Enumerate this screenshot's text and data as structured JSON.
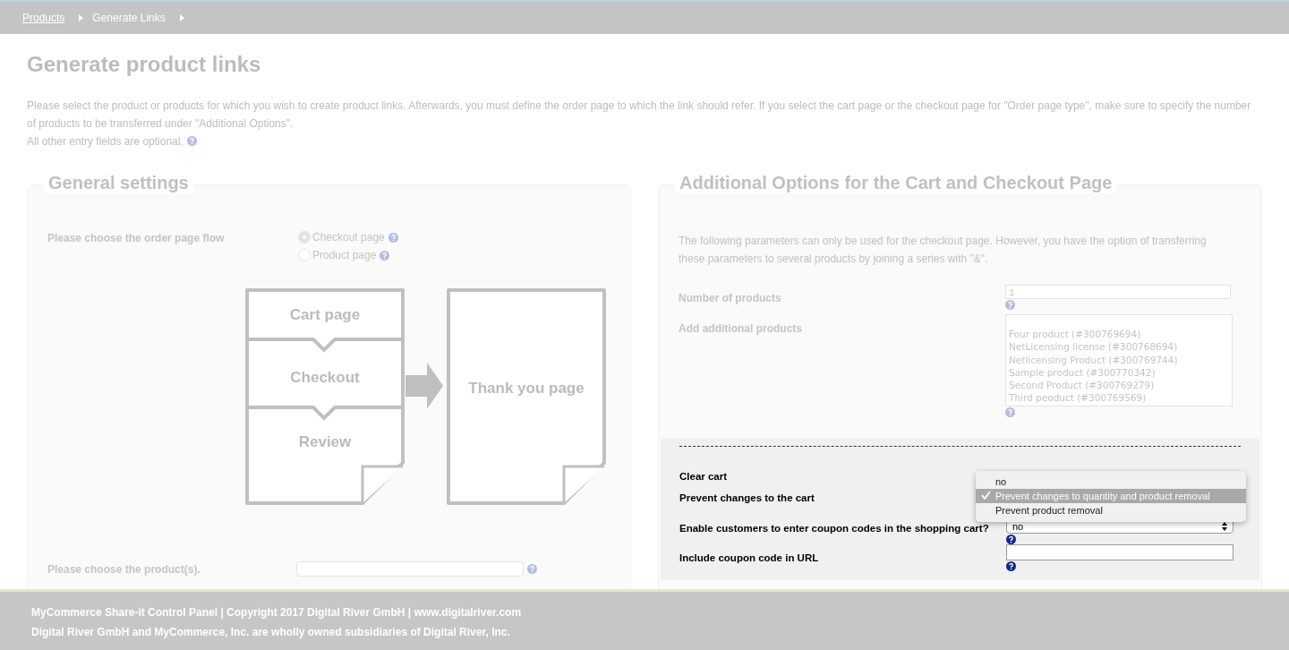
{
  "breadcrumb": [
    {
      "label": "Products",
      "kind": "link"
    },
    {
      "label": "Generate Links",
      "kind": "current"
    }
  ],
  "title": "Generate product links",
  "intro": [
    "Please select the product or products for which you wish to create product links. Afterwards, you must define the order page to which the link should refer. If you select the cart page or the checkout page for \"Order page type\", make sure to specify the number of products to be transferred under \"Additional Options\".",
    "All other entry fields are optional."
  ],
  "general": {
    "title": "General settings",
    "flow_label": "Please choose the order page flow",
    "flow_options": [
      {
        "label": "Checkout page",
        "selected": true
      },
      {
        "label": "Product page",
        "selected": false
      }
    ],
    "diagram": {
      "steps": [
        "Cart page",
        "Checkout",
        "Review"
      ],
      "final": "Thank you page"
    },
    "product_label": "Please choose the product(s)."
  },
  "additional": {
    "title": "Additional Options for the Cart and Checkout Page",
    "description": "The following parameters can only be used for the checkout page. However, you have the option of transferring these parameters to several products by joining a series with \"&\".",
    "number_label": "Number of products",
    "number_value": "1",
    "add_label": "Add additional products",
    "products": [
      "Four product (#300769694)",
      "NetLicensing license (#300768694)",
      "Netlicensing Product (#300769744)",
      "Sample product (#300770342)",
      "Second Product (#300769279)",
      "Third peoduct (#300769569)"
    ],
    "clear_label": "Clear cart",
    "prevent_label": "Prevent changes to the cart",
    "dropdown": [
      {
        "label": "no",
        "selected": false
      },
      {
        "label": "Prevent changes to quantity and product removal",
        "selected": true
      },
      {
        "label": "Prevent product removal",
        "selected": false
      }
    ],
    "coupon_label": "Enable customers to enter coupon codes in the shopping cart?",
    "coupon_value": "no",
    "url_label": "Include coupon code in URL"
  },
  "footer": [
    "MyCommerce Share-it Control Panel | Copyright 2017 Digital River GmbH | www.digitalriver.com",
    "Digital River GmbH and MyCommerce, Inc. are wholly owned subsidiaries of Digital River, Inc."
  ]
}
